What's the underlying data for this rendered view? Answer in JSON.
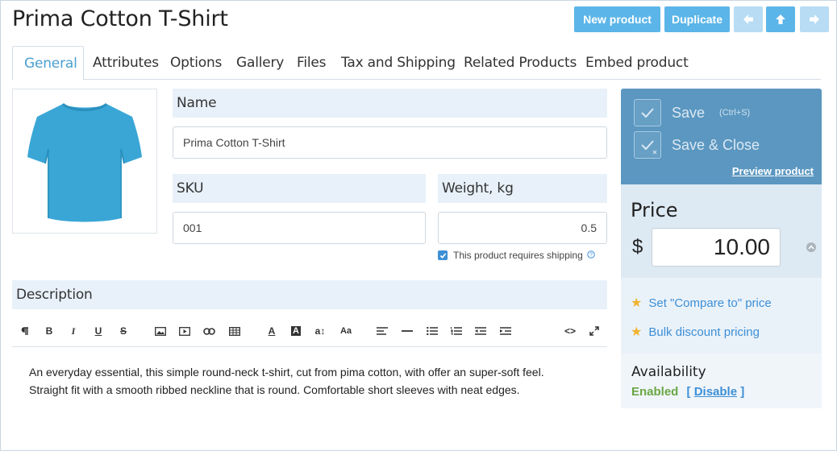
{
  "page": {
    "title": "Prima Cotton T-Shirt"
  },
  "header": {
    "new_product": "New product",
    "duplicate": "Duplicate",
    "accent": "#5bb5e8"
  },
  "tabs": [
    {
      "label": "General",
      "active": true
    },
    {
      "label": "Attributes"
    },
    {
      "label": "Options"
    },
    {
      "label": "Gallery"
    },
    {
      "label": "Files"
    },
    {
      "label": "Tax and Shipping"
    },
    {
      "label": "Related Products"
    },
    {
      "label": "Embed product"
    }
  ],
  "fields": {
    "name_label": "Name",
    "name_value": "Prima Cotton T-Shirt",
    "sku_label": "SKU",
    "sku_value": "001",
    "weight_label": "Weight, kg",
    "weight_value": "0.5",
    "shipping_checkbox": "This product requires shipping",
    "shipping_checked": true
  },
  "description": {
    "label": "Description",
    "toolbar": {
      "bold": "B",
      "italic": "I",
      "underline": "U",
      "strike": "S",
      "text_color": "A",
      "bg_color": "A",
      "font_size": "a↕",
      "case": "Aa",
      "code": "<>"
    },
    "line1": "An everyday essential, this simple round-neck t-shirt, cut from pima cotton, with offer an super-soft feel.",
    "line2": "Straight fit with a smooth ribbed neckline that is round. Comfortable short sleeves with neat edges."
  },
  "save_panel": {
    "save": "Save",
    "save_shortcut": "(Ctrl+S)",
    "save_close": "Save & Close",
    "preview": "Preview product",
    "bg_color": "#5b97c0"
  },
  "price": {
    "label": "Price",
    "currency": "$",
    "value": "10.00"
  },
  "links": {
    "compare": "Set \"Compare to\" price",
    "bulk": "Bulk discount pricing"
  },
  "availability": {
    "label": "Availability",
    "status": "Enabled",
    "bracket_open": "[",
    "action": "Disable",
    "bracket_close": "]",
    "status_color": "#6aa744"
  },
  "product_image": {
    "icon": "tshirt-image",
    "color": "#3aa6d6"
  }
}
